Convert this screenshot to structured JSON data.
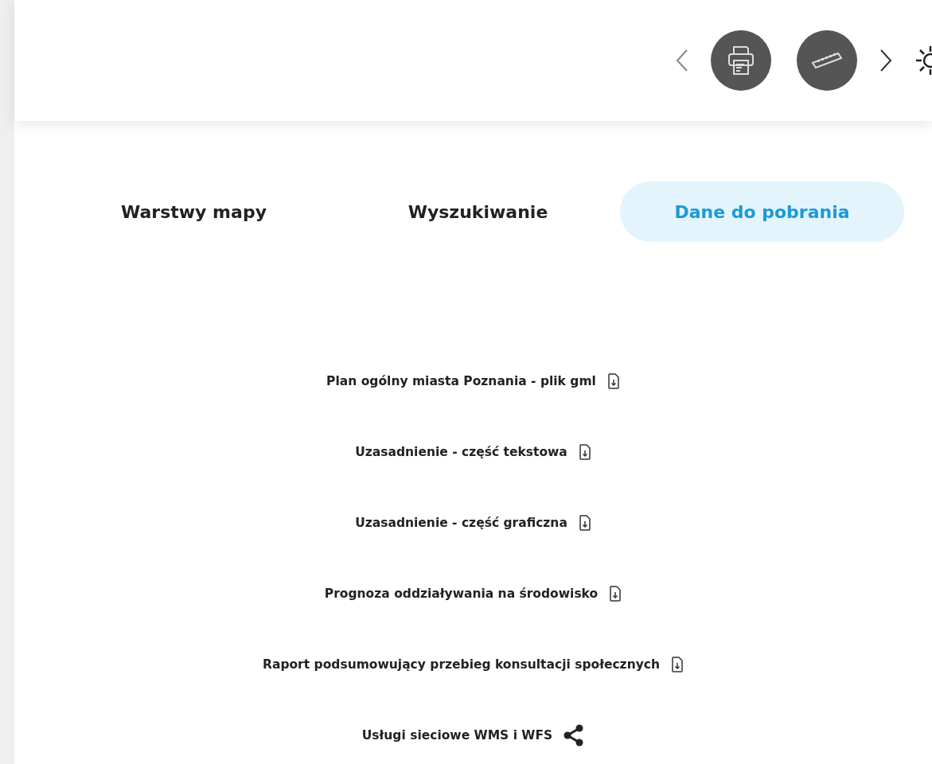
{
  "tabs": [
    {
      "label": "Warstwy mapy",
      "selected": false
    },
    {
      "label": "Wyszukiwanie",
      "selected": false
    },
    {
      "label": "Dane do pobrania",
      "selected": true
    }
  ],
  "downloads": [
    {
      "label": "Plan ogólny miasta Poznania - plik gml",
      "kind": "file"
    },
    {
      "label": "Uzasadnienie - część tekstowa",
      "kind": "file"
    },
    {
      "label": "Uzasadnienie - część graficzna",
      "kind": "file"
    },
    {
      "label": "Prognoza oddziaływania na środowisko",
      "kind": "file"
    },
    {
      "label": "Raport podsumowujący przebieg konsultacji społecznych",
      "kind": "file"
    },
    {
      "label": "Usługi sieciowe WMS i WFS",
      "kind": "share"
    }
  ]
}
